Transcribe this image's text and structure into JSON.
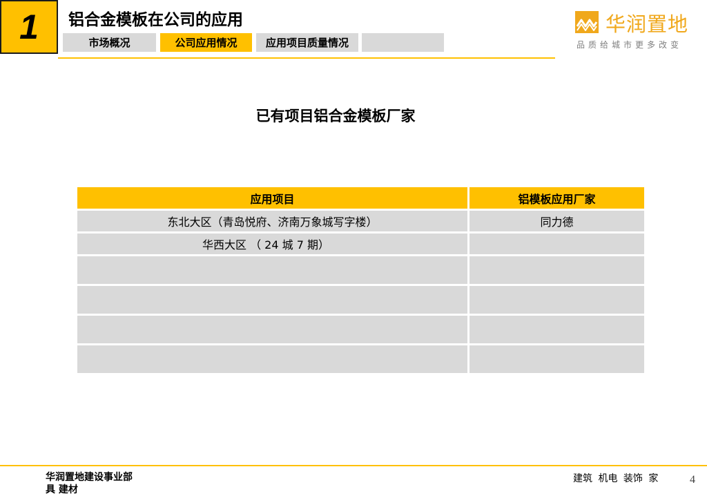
{
  "section": {
    "number": "1",
    "title": "铝合金模板在公司的应用"
  },
  "tabs": [
    {
      "label": "市场概况",
      "active": false
    },
    {
      "label": "公司应用情况",
      "active": true
    },
    {
      "label": "应用项目质量情况",
      "active": false
    },
    {
      "label": "",
      "active": false
    }
  ],
  "logo": {
    "name": "华润置地",
    "slogan": "品质给城市更多改变"
  },
  "subtitle": "已有项目铝合金模板厂家",
  "table": {
    "headers": [
      "应用项目",
      "铝模板应用厂家"
    ],
    "rows": [
      [
        "东北大区（青岛悦府、济南万象城写字楼）",
        "同力德"
      ],
      [
        "华西大区 （ 24 城 7 期）",
        ""
      ],
      [
        "",
        ""
      ],
      [
        "",
        ""
      ],
      [
        "",
        ""
      ],
      [
        "",
        ""
      ]
    ]
  },
  "footer": {
    "line1": "华润置地建设事业部",
    "line2": "具 建材",
    "right": "建筑 机电 装饰 家",
    "page": "4"
  },
  "colors": {
    "accent": "#ffc000",
    "cell": "#d9d9d9",
    "logo": "#f0a81c"
  }
}
